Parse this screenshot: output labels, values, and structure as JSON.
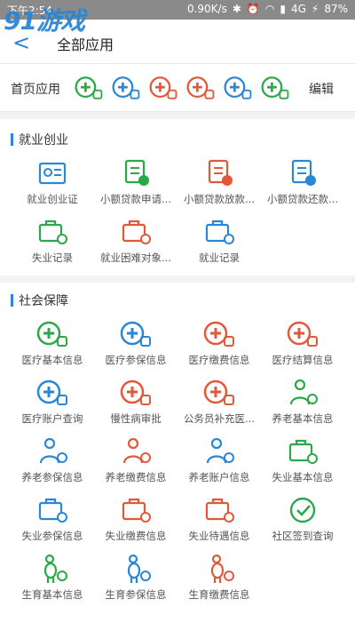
{
  "status": {
    "time": "下午2:54",
    "speed": "0.90K/s",
    "network": "4G",
    "battery": "87%"
  },
  "watermark": "91游戏",
  "header": {
    "back_label": "<",
    "title": "全部应用"
  },
  "home": {
    "label": "首页应用",
    "edit": "编辑",
    "icons": [
      "cross-person-icon",
      "cross-shield-icon",
      "cross-coin-icon",
      "cross-card-icon",
      "cross-list-icon",
      "person-list-icon"
    ]
  },
  "sections": [
    {
      "title": "就业创业",
      "items": [
        {
          "label": "就业创业证",
          "icon": "card-id-icon",
          "color": "#2a86d6"
        },
        {
          "label": "小额贷款申请...",
          "icon": "loan-apply-icon",
          "color": "#2aa84a"
        },
        {
          "label": "小额贷款放款...",
          "icon": "loan-release-icon",
          "color": "#e05a3a"
        },
        {
          "label": "小额贷款还款...",
          "icon": "loan-repay-icon",
          "color": "#2a86d6"
        },
        {
          "label": "失业记录",
          "icon": "unemploy-clock-icon",
          "color": "#2aa84a"
        },
        {
          "label": "就业困难对象...",
          "icon": "difficulty-icon",
          "color": "#e05a3a"
        },
        {
          "label": "就业记录",
          "icon": "briefcase-clock-icon",
          "color": "#2a86d6"
        }
      ]
    },
    {
      "title": "社会保障",
      "items": [
        {
          "label": "医疗基本信息",
          "icon": "medical-basic-icon",
          "color": "#2aa84a"
        },
        {
          "label": "医疗参保信息",
          "icon": "medical-insure-icon",
          "color": "#2a86d6"
        },
        {
          "label": "医疗缴费信息",
          "icon": "medical-pay-icon",
          "color": "#e05a3a"
        },
        {
          "label": "医疗结算信息",
          "icon": "medical-settle-icon",
          "color": "#e05a3a"
        },
        {
          "label": "医疗账户查询",
          "icon": "medical-account-icon",
          "color": "#2a86d6"
        },
        {
          "label": "慢性病审批",
          "icon": "chronic-approve-icon",
          "color": "#e05a3a"
        },
        {
          "label": "公务员补充医...",
          "icon": "civil-medical-icon",
          "color": "#e05a3a"
        },
        {
          "label": "养老基本信息",
          "icon": "pension-basic-icon",
          "color": "#2aa84a"
        },
        {
          "label": "养老参保信息",
          "icon": "pension-insure-icon",
          "color": "#2a86d6"
        },
        {
          "label": "养老缴费信息",
          "icon": "pension-pay-icon",
          "color": "#e05a3a"
        },
        {
          "label": "养老账户信息",
          "icon": "pension-account-icon",
          "color": "#2a86d6"
        },
        {
          "label": "失业基本信息",
          "icon": "unemploy-basic-icon",
          "color": "#2aa84a"
        },
        {
          "label": "失业参保信息",
          "icon": "unemploy-insure-icon",
          "color": "#2a86d6"
        },
        {
          "label": "失业缴费信息",
          "icon": "unemploy-pay-icon",
          "color": "#e05a3a"
        },
        {
          "label": "失业待遇信息",
          "icon": "unemploy-benefit-icon",
          "color": "#e05a3a"
        },
        {
          "label": "社区签到查询",
          "icon": "sign-in-icon",
          "color": "#2aa84a"
        },
        {
          "label": "生育基本信息",
          "icon": "maternity-basic-icon",
          "color": "#2aa84a"
        },
        {
          "label": "生育参保信息",
          "icon": "maternity-insure-icon",
          "color": "#2a86d6"
        },
        {
          "label": "生育缴费信息",
          "icon": "maternity-pay-icon",
          "color": "#e05a3a"
        }
      ]
    }
  ]
}
